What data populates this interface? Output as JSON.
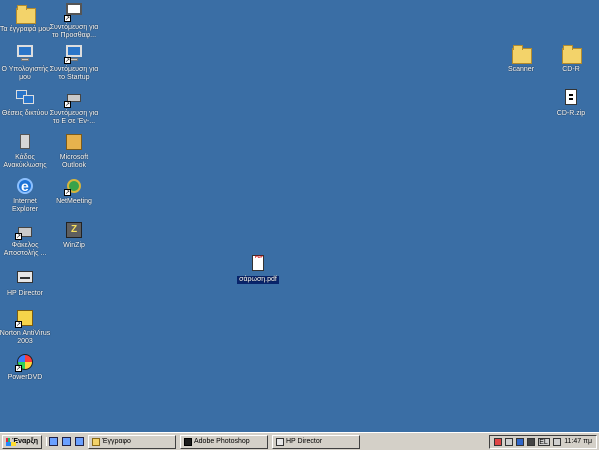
{
  "desktop": {
    "icons": {
      "my_documents": {
        "label": "Τα έγγραφά μου"
      },
      "shortcut_protect": {
        "label": "Συντόμευση για\nτο Προσθαφ..."
      },
      "my_computer": {
        "label": "Ο Υπολογιστής\nμου"
      },
      "shortcut_startup": {
        "label": "Συντόμευση για\nτο Startup"
      },
      "network_places": {
        "label": "Θέσεις δικτύου"
      },
      "shortcut_e": {
        "label": "Συντόμευση για\nτο Ε σε 'Εν-..."
      },
      "recycle_bin": {
        "label": "Κάδος\nΑνακύκλωσης"
      },
      "outlook": {
        "label": "Microsoft\nOutlook"
      },
      "internet_explorer": {
        "label": "Internet\nExplorer"
      },
      "netmeeting": {
        "label": "NetMeeting"
      },
      "sending_folder": {
        "label": "Φάκελος\nΑποστολής ..."
      },
      "winzip": {
        "label": "WinZip"
      },
      "hp_director": {
        "label": "HP Director"
      },
      "norton": {
        "label": "Norton AntiVirus\n2003"
      },
      "powerdvd": {
        "label": "PowerDVD"
      },
      "scanner": {
        "label": "Scanner"
      },
      "cdr": {
        "label": "CD-R"
      },
      "cdr_zip": {
        "label": "CD-R.zip"
      },
      "pdf_file": {
        "label": "σάρωση.pdf"
      }
    }
  },
  "taskbar": {
    "start_label": "Έναρξη",
    "tasks": [
      {
        "label": "Έγγραφο"
      },
      {
        "label": "Adobe Photoshop"
      },
      {
        "label": "HP Director"
      }
    ],
    "tray": {
      "lang": "EL",
      "time": "11:47 πμ"
    }
  }
}
